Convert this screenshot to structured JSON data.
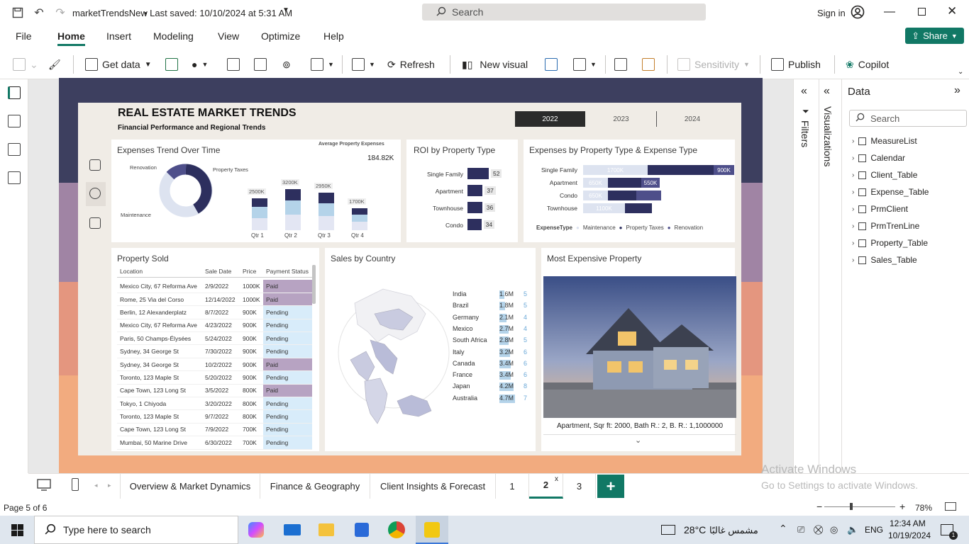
{
  "app": {
    "title": "marketTrendsNew",
    "saved": "• Last saved: 10/10/2024 at 5:31 AM",
    "search_placeholder": "Search",
    "sign_in": "Sign in"
  },
  "menu": {
    "file": "File",
    "home": "Home",
    "insert": "Insert",
    "modeling": "Modeling",
    "view": "View",
    "optimize": "Optimize",
    "help": "Help",
    "share": "Share"
  },
  "ribbon": {
    "get_data": "Get data",
    "refresh": "Refresh",
    "new_visual": "New visual",
    "sensitivity": "Sensitivity",
    "publish": "Publish",
    "copilot": "Copilot"
  },
  "report": {
    "title": "REAL ESTATE MARKET TRENDS",
    "subtitle": "Financial Performance and Regional Trends",
    "years": [
      "2022",
      "2023",
      "2024"
    ],
    "selected_year": "2022"
  },
  "expenses_trend": {
    "title": "Expenses Trend Over Time",
    "avg_label": "Average Property Expenses",
    "avg_value": "184.82K",
    "donut_labels": [
      "Renovation",
      "Property Taxes",
      "Maintenance"
    ],
    "quarters": [
      "Qtr 1",
      "Qtr 2",
      "Qtr 3",
      "Qtr 4"
    ],
    "totals": [
      "2500K",
      "3200K",
      "2950K",
      "1700K"
    ],
    "total_values": [
      2500,
      3200,
      2950,
      1700
    ]
  },
  "roi": {
    "title": "ROI by Property Type",
    "rows": [
      {
        "label": "Single Family",
        "value": "52",
        "v": 52
      },
      {
        "label": "Apartment",
        "value": "37",
        "v": 37
      },
      {
        "label": "Townhouse",
        "value": "36",
        "v": 36
      },
      {
        "label": "Condo",
        "value": "34",
        "v": 34
      }
    ]
  },
  "expenses_by_type": {
    "title": "Expenses by Property Type & Expense Type",
    "rows": [
      {
        "label": "Single Family",
        "seg": [
          "1700K",
          "",
          "900K"
        ]
      },
      {
        "label": "Apartment",
        "seg": [
          "650K",
          "",
          "550K"
        ]
      },
      {
        "label": "Condo",
        "seg": [
          "650K",
          "",
          ""
        ]
      },
      {
        "label": "Townhouse",
        "seg": [
          "1100K",
          "",
          ""
        ]
      }
    ],
    "legend_title": "ExpenseType",
    "legend": [
      "Maintenance",
      "Property Taxes",
      "Renovation"
    ]
  },
  "property_sold": {
    "title": "Property Sold",
    "columns": [
      "Location",
      "Sale Date",
      "Price",
      "Payment Status"
    ],
    "rows": [
      [
        "Mexico City, 67 Reforma Ave",
        "2/9/2022",
        "1000K",
        "Paid"
      ],
      [
        "Rome, 25 Via del Corso",
        "12/14/2022",
        "1000K",
        "Paid"
      ],
      [
        "Berlin, 12 Alexanderplatz",
        "8/7/2022",
        "900K",
        "Pending"
      ],
      [
        "Mexico City, 67 Reforma Ave",
        "4/23/2022",
        "900K",
        "Pending"
      ],
      [
        "Paris, 50 Champs-Élysées",
        "5/24/2022",
        "900K",
        "Pending"
      ],
      [
        "Sydney, 34 George St",
        "7/30/2022",
        "900K",
        "Pending"
      ],
      [
        "Sydney, 34 George St",
        "10/2/2022",
        "900K",
        "Paid"
      ],
      [
        "Toronto, 123 Maple St",
        "5/20/2022",
        "900K",
        "Pending"
      ],
      [
        "Cape Town, 123 Long St",
        "3/5/2022",
        "800K",
        "Paid"
      ],
      [
        "Tokyo, 1 Chiyoda",
        "3/20/2022",
        "800K",
        "Pending"
      ],
      [
        "Toronto, 123 Maple St",
        "9/7/2022",
        "800K",
        "Pending"
      ],
      [
        "Cape Town, 123 Long St",
        "7/9/2022",
        "700K",
        "Pending"
      ],
      [
        "Mumbai, 50 Marine Drive",
        "6/30/2022",
        "700K",
        "Pending"
      ]
    ]
  },
  "sales_by_country": {
    "title": "Sales by Country",
    "rows": [
      {
        "country": "India",
        "sales": "1.6M",
        "count": "5",
        "v": 1.6
      },
      {
        "country": "Brazil",
        "sales": "1.8M",
        "count": "5",
        "v": 1.8
      },
      {
        "country": "Germany",
        "sales": "2.1M",
        "count": "4",
        "v": 2.1
      },
      {
        "country": "Mexico",
        "sales": "2.7M",
        "count": "4",
        "v": 2.7
      },
      {
        "country": "South Africa",
        "sales": "2.8M",
        "count": "5",
        "v": 2.8
      },
      {
        "country": "Italy",
        "sales": "3.2M",
        "count": "6",
        "v": 3.2
      },
      {
        "country": "Canada",
        "sales": "3.4M",
        "count": "6",
        "v": 3.4
      },
      {
        "country": "France",
        "sales": "3.4M",
        "count": "6",
        "v": 3.4
      },
      {
        "country": "Japan",
        "sales": "4.2M",
        "count": "8",
        "v": 4.2
      },
      {
        "country": "Australia",
        "sales": "4.7M",
        "count": "7",
        "v": 4.7
      }
    ]
  },
  "most_expensive": {
    "title": "Most Expensive Property",
    "caption": "Apartment, Sqr ft: 2000, Bath R.: 2, B. R.: 1,1000000"
  },
  "panes": {
    "filters": "Filters",
    "visualizations": "Visualizations",
    "data": "Data",
    "search": "Search"
  },
  "data_tables": [
    "MeasureList",
    "Calendar",
    "Client_Table",
    "Expense_Table",
    "PrmClient",
    "PrmTrenLine",
    "Property_Table",
    "Sales_Table"
  ],
  "page_tabs": [
    "Overview & Market Dynamics",
    "Finance & Geography",
    "Client Insights & Forecast",
    "1",
    "2",
    "3"
  ],
  "status": {
    "page": "Page 5 of 6",
    "zoom": "78%"
  },
  "watermark": {
    "line1": "Activate Windows",
    "line2": "Go to Settings to activate Windows."
  },
  "taskbar": {
    "search": "Type here to search",
    "weather": "28°C",
    "weather_text": "مشمس غالبًا",
    "lang": "ENG",
    "time": "12:34 AM",
    "date": "10/19/2024",
    "notif": "1"
  },
  "colors": {
    "accent": "#117865",
    "navy": "#2d2f5e",
    "mid": "#b4d3e9",
    "light": "#dde3f0",
    "paid": "#b7a3c2",
    "pending": "#d8ecfa"
  }
}
